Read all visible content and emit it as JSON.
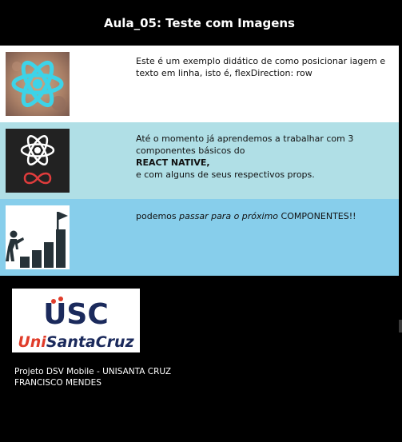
{
  "header": {
    "title": "Aula_05: Teste com Imagens"
  },
  "rows": [
    {
      "icon": "react-logo-icon",
      "text": " Este é um exemplo didático de como posicionar iagem e texto em linha, isto é, flexDirection: row"
    },
    {
      "icon": "react-native-logo-icon",
      "line1": "Até o momento já aprendemos a trabalhar com 3 componentes básicos do",
      "strong": "REACT NATIVE,",
      "line2": "e com alguns de seus respectivos props."
    },
    {
      "icon": "stairs-goal-icon",
      "prefix": "podemos ",
      "emph": "passar para o próximo",
      "suffix": "  COMPONENTES!!"
    }
  ],
  "logo": {
    "usc": "USC",
    "name_uni": "Uni",
    "name_rest": "SantaCruz"
  },
  "footer": {
    "line1": "Projeto DSV Mobile - UNISANTA CRUZ",
    "line2": "FRANCISCO MENDES"
  },
  "colors": {
    "row1": "#ffffff",
    "row2": "#b0dfe6",
    "row3": "#87ceeb",
    "react_cyan": "#3dd3e8",
    "logo_navy": "#1b2a5c",
    "logo_red": "#e03c2a"
  }
}
